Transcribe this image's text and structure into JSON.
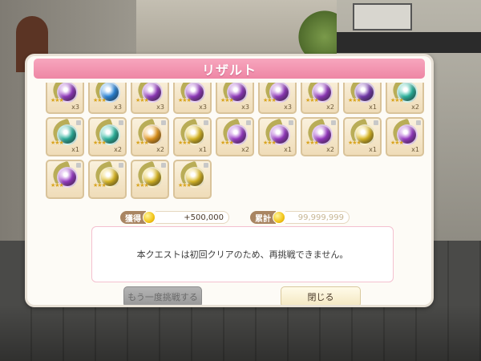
{
  "dialog": {
    "title": "リザルト",
    "message": "本クエストは初回クリアのため、再挑戦できません。"
  },
  "items": [
    {
      "count": "x3",
      "color": "#9b3fc9"
    },
    {
      "count": "x3",
      "color": "#2f8ee6"
    },
    {
      "count": "x3",
      "color": "#9b3fc9"
    },
    {
      "count": "x3",
      "color": "#9b3fc9"
    },
    {
      "count": "x3",
      "color": "#9b3fc9"
    },
    {
      "count": "x3",
      "color": "#9b3fc9"
    },
    {
      "count": "x2",
      "color": "#9b3fc9"
    },
    {
      "count": "x1",
      "color": "#7d3fb8"
    },
    {
      "count": "x2",
      "color": "#2fc0a8"
    },
    {
      "count": "x1",
      "color": "#2fb8a4"
    },
    {
      "count": "x2",
      "color": "#2fc0a8"
    },
    {
      "count": "x2",
      "color": "#f0a020"
    },
    {
      "count": "x1",
      "color": "#e8c428"
    },
    {
      "count": "x2",
      "color": "#a23fd0"
    },
    {
      "count": "x1",
      "color": "#a23fd0"
    },
    {
      "count": "x2",
      "color": "#a23fd0"
    },
    {
      "count": "x1",
      "color": "#e8c428"
    },
    {
      "count": "x1",
      "color": "#a23fd0"
    },
    {
      "count": "",
      "color": "#a23fd0"
    },
    {
      "count": "",
      "color": "#e8c428"
    },
    {
      "count": "",
      "color": "#e8c428"
    },
    {
      "count": "",
      "color": "#e8c428"
    }
  ],
  "stats": {
    "gain_label": "獲得",
    "gain_value": "+500,000",
    "total_label": "累計",
    "total_value": "99,999,999"
  },
  "buttons": {
    "retry": "もう一度挑戦する",
    "close": "閉じる"
  },
  "colors": {
    "title_bar": "#ee86a5",
    "accent_brown": "#a98562"
  }
}
